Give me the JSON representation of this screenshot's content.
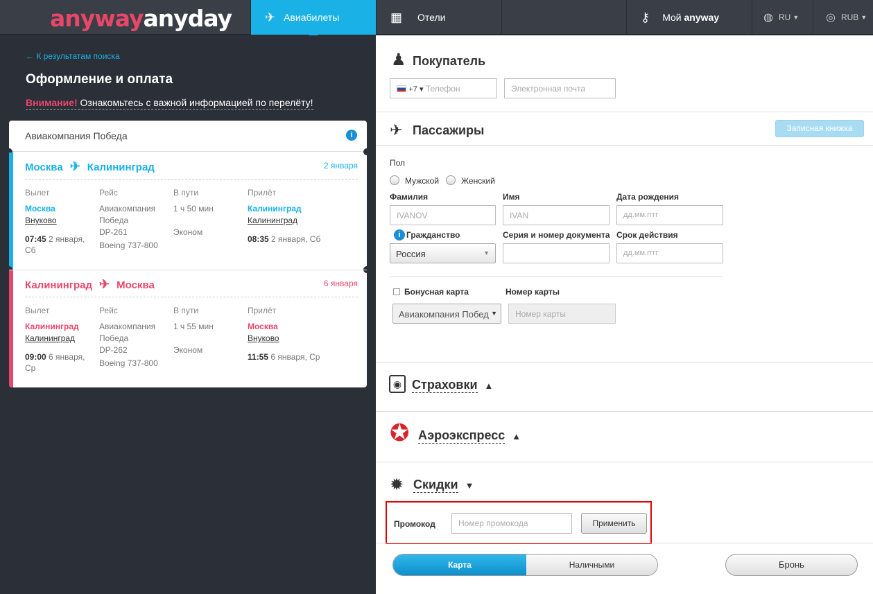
{
  "header": {
    "logo_part1": "anyway",
    "logo_part2": "anyday",
    "nav": {
      "flights": "Авиабилеты",
      "hotels": "Отели",
      "my": "Мой",
      "my_bold": "anyway",
      "lang": "RU",
      "currency": "RUB"
    }
  },
  "left": {
    "back_link": "← К результатам поиска",
    "title": "Оформление и оплата",
    "warning_label": "Внимание!",
    "warning_text": " Ознакомьтесь с важной информацией по перелёту!",
    "airline": "Авиакомпания Победа",
    "segments": [
      {
        "from": "Москва",
        "to": "Калининград",
        "date": "2 января",
        "dep_label": "Вылет",
        "flight_label": "Рейс",
        "duration_label": "В пути",
        "arr_label": "Прилёт",
        "dep_city": "Москва",
        "dep_airport": "Внуково",
        "carrier": "Авиакомпания Победа",
        "flight_no": "DP-261",
        "aircraft": "Boeing 737-800",
        "duration": "1 ч 50 мин",
        "cabin": "Эконом",
        "arr_city": "Калининград",
        "arr_airport": "Калининград",
        "dep_time": "07:45",
        "dep_date": " 2 января, Сб",
        "arr_time": "08:35",
        "arr_date": " 2 января, Сб"
      },
      {
        "from": "Калининград",
        "to": "Москва",
        "date": "6 января",
        "dep_label": "Вылет",
        "flight_label": "Рейс",
        "duration_label": "В пути",
        "arr_label": "Прилёт",
        "dep_city": "Калининград",
        "dep_airport": "Калининград",
        "carrier": "Авиакомпания Победа",
        "flight_no": "DP-262",
        "aircraft": "Boeing 737-800",
        "duration": "1 ч 55 мин",
        "cabin": "Эконом",
        "arr_city": "Москва",
        "arr_airport": "Внуково",
        "dep_time": "09:00",
        "dep_date": " 6 января, Ср",
        "arr_time": "11:55",
        "arr_date": " 6 января, Ср"
      }
    ]
  },
  "buyer": {
    "title": "Покупатель",
    "phone_code": "+7 ▾",
    "phone_placeholder": "Телефон",
    "email_placeholder": "Электронная почта"
  },
  "passengers": {
    "title": "Пассажиры",
    "address_book": "Записная книжка",
    "gender_label": "Пол",
    "male": "Мужской",
    "female": "Женский",
    "surname_label": "Фамилия",
    "surname_placeholder": "IVANOV",
    "name_label": "Имя",
    "name_placeholder": "IVAN",
    "dob_label": "Дата рождения",
    "dob_placeholder": "дд.мм.гггг",
    "citizenship_label": "Гражданство",
    "citizenship_value": "Россия",
    "doc_label": "Серия и номер документа",
    "expiry_label": "Срок действия",
    "expiry_placeholder": "дд.мм.гггг",
    "bonus_label": "Бонусная карта",
    "bonus_airline": "Авиакомпания Побед",
    "card_no_label": "Номер карты",
    "card_no_placeholder": "Номер карты"
  },
  "insurance": {
    "title": "Страховки",
    "arrow": "▲"
  },
  "aeroexpress": {
    "title": "Аэроэкспресс",
    "arrow": "▲"
  },
  "discounts": {
    "title": "Скидки",
    "arrow": "▼",
    "promo_label": "Промокод",
    "promo_placeholder": "Номер промокода",
    "apply": "Применить"
  },
  "payment": {
    "card": "Карта",
    "cash": "Наличными",
    "book": "Бронь"
  },
  "colors": {
    "accent": "#1ab1e6",
    "pink": "#e8476a",
    "dark": "#2b2f37",
    "highlight": "#e00000"
  }
}
